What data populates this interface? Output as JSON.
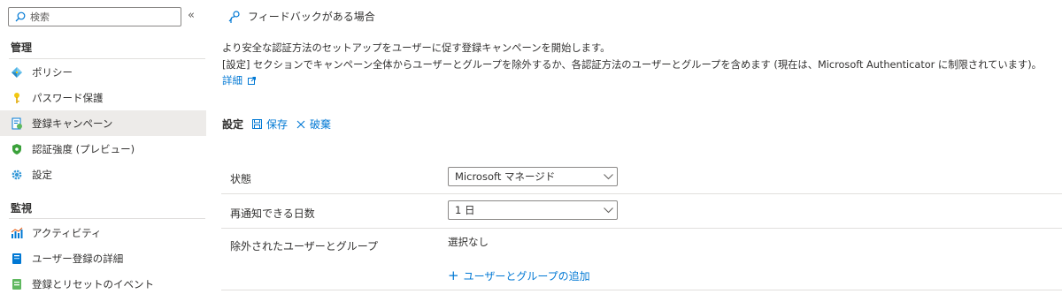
{
  "sidebar": {
    "search": {
      "placeholder": "検索",
      "value": ""
    },
    "collapse_glyph": "«",
    "sections": {
      "manage": "管理",
      "monitor": "監視"
    },
    "manage_items": [
      {
        "label": "ポリシー",
        "icon": "policy-icon"
      },
      {
        "label": "パスワード保護",
        "icon": "key-icon"
      },
      {
        "label": "登録キャンペーン",
        "icon": "registration-campaign-icon",
        "active": true
      },
      {
        "label": "認証強度 (プレビュー)",
        "icon": "shield-icon"
      },
      {
        "label": "設定",
        "icon": "gear-icon"
      }
    ],
    "monitor_items": [
      {
        "label": "アクティビティ",
        "icon": "activity-chart-icon"
      },
      {
        "label": "ユーザー登録の詳細",
        "icon": "user-registration-details-icon"
      },
      {
        "label": "登録とリセットのイベント",
        "icon": "events-icon"
      }
    ]
  },
  "main": {
    "feedback_label": "フィードバックがある場合",
    "description_line1": "より安全な認証方法のセットアップをユーザーに促す登録キャンペーンを開始します。",
    "description_line2": "[設定] セクションでキャンペーン全体からユーザーとグループを除外するか、各認証方法のユーザーとグループを含めます (現在は、Microsoft Authenticator に制限されています)。",
    "learn_more": "詳細",
    "settings_title": "設定",
    "save_label": "保存",
    "discard_label": "破棄",
    "rows": {
      "state_label": "状態",
      "state_value": "Microsoft マネージド",
      "snooze_label": "再通知できる日数",
      "snooze_value": "1 日",
      "excluded_label": "除外されたユーザーとグループ",
      "excluded_value": "選択なし",
      "add_label": "ユーザーとグループの追加"
    }
  },
  "colors": {
    "accent": "#0078d4",
    "active_bg": "#edebe9",
    "border": "#8a8886",
    "divider": "#e1dfdd"
  }
}
